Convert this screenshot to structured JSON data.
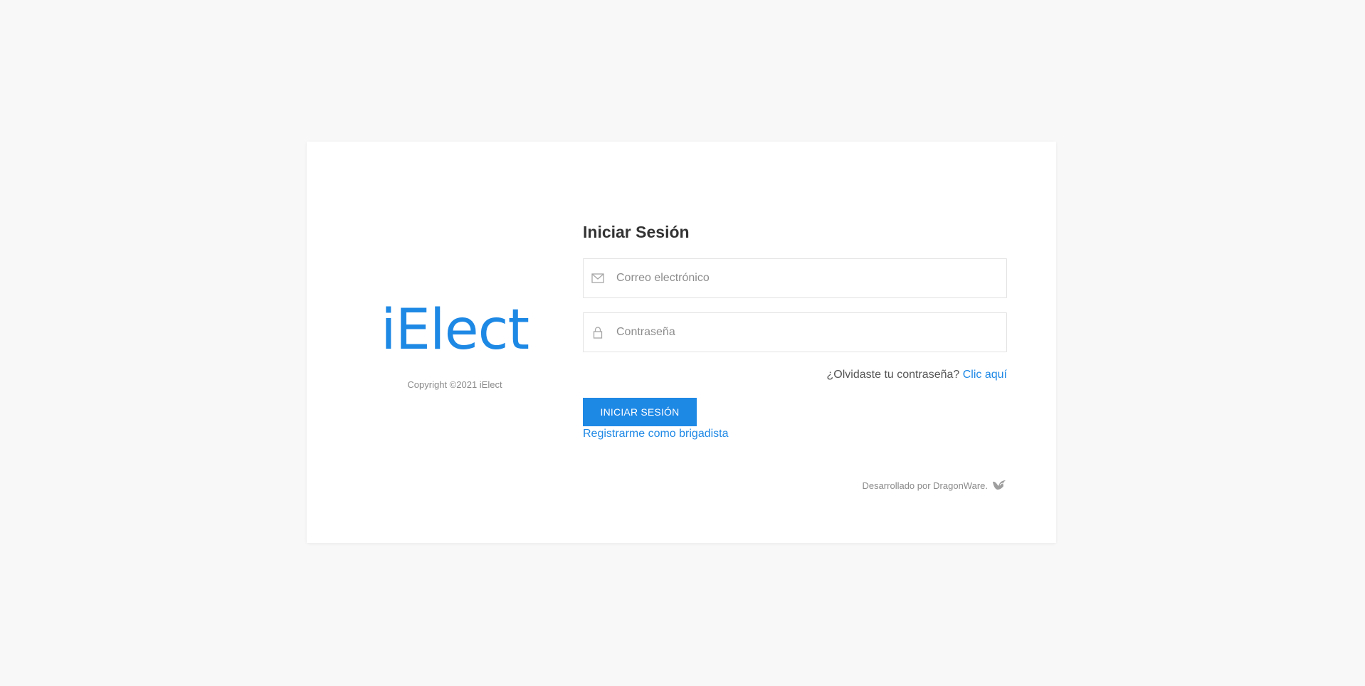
{
  "brand": {
    "logo_text": "iElect",
    "copyright": "Copyright ©2021 iElect"
  },
  "login": {
    "title": "Iniciar Sesión",
    "email": {
      "placeholder": "Correo electrónico",
      "value": "",
      "icon": "envelope-icon"
    },
    "password": {
      "placeholder": "Contraseña",
      "value": "",
      "icon": "lock-icon"
    },
    "forgot_text": "¿Olvidaste tu contraseña?",
    "forgot_link": "Clic aquí",
    "submit_label": "INICIAR SESIÓN",
    "register_link": "Registrarme como brigadista"
  },
  "footer": {
    "credit": "Desarrollado por DragonWare.",
    "credit_icon": "dragon-logo-icon"
  },
  "colors": {
    "accent": "#1e88e5",
    "background": "#f8f8f8",
    "card": "#ffffff"
  }
}
